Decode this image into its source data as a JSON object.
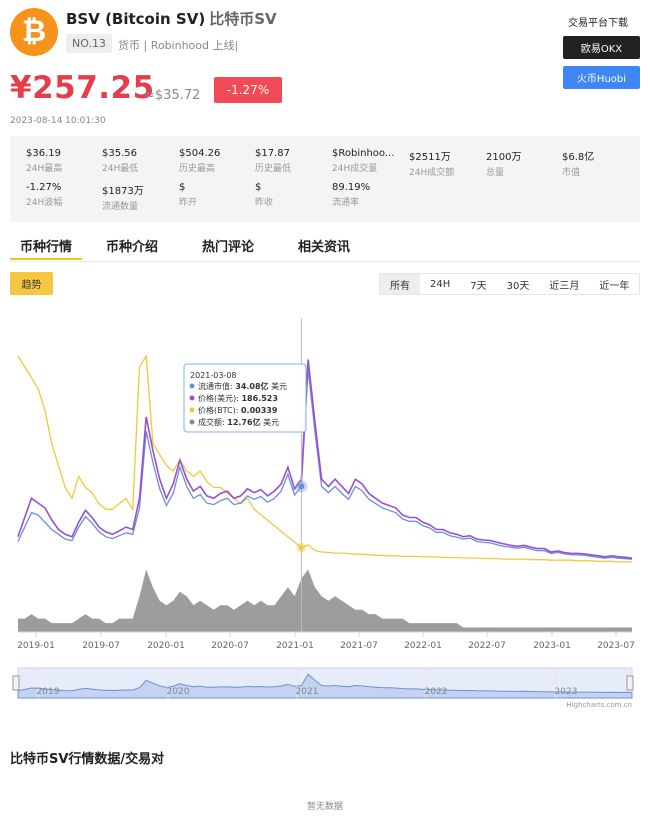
{
  "coin": {
    "logo_glyph": "₿",
    "name": "BSV (Bitcoin SV)",
    "name_cn": "比特币SV",
    "rank": "NO.13",
    "tags": "货币 | Robinhood 上线|",
    "price": "¥257.25",
    "price_usd": "≈$35.72",
    "change": "-1.27%",
    "timestamp": "2023-08-14 10:01:30"
  },
  "exchanges": {
    "title": "交易平台下载",
    "okx": "欧易OKX",
    "huobi": "火币Huobi"
  },
  "stats": [
    {
      "value": "$36.19",
      "label": "24H最高"
    },
    {
      "value": "$35.56",
      "label": "24H最低"
    },
    {
      "value": "$504.26",
      "label": "历史最高"
    },
    {
      "value": "$17.87",
      "label": "历史最低"
    },
    {
      "value": "$Robinhoo...",
      "label": "24H成交量"
    },
    {
      "value": "$2511万",
      "label": "24H成交额"
    },
    {
      "value": "2100万",
      "label": "总量"
    },
    {
      "value": "$6.8亿",
      "label": "市值"
    },
    {
      "value": "-1.27%",
      "label": "24H波幅"
    },
    {
      "value": "$1873万",
      "label": "流通数量"
    },
    {
      "value": "$",
      "label": "昨开"
    },
    {
      "value": "$",
      "label": "昨收"
    },
    {
      "value": "89.19%",
      "label": "流通率"
    }
  ],
  "tabs": [
    "币种行情",
    "币种介绍",
    "热门评论",
    "相关资讯"
  ],
  "controls": {
    "trend": "趋势",
    "ranges": [
      "所有",
      "24H",
      "7天",
      "30天",
      "近三月",
      "近一年"
    ],
    "active_range": "所有"
  },
  "colors": {
    "accent": "#f5c518",
    "price_red": "#e63d4b",
    "market_cap": "#6a8fde",
    "price_usd": "#9b4fd0",
    "price_btc": "#f0c93c",
    "volume": "#8c8c8c"
  },
  "chart_data": {
    "type": "line",
    "x_labels": [
      "2019-01",
      "2019-07",
      "2020-01",
      "2020-07",
      "2021-01",
      "2021-07",
      "2022-01",
      "2022-07",
      "2023-01",
      "2023-07"
    ],
    "navigator_labels": [
      "2019",
      "2020",
      "2021",
      "2022",
      "2023"
    ],
    "credit": "Highcharts.com.cn",
    "tooltip": {
      "date": "2021-03-08",
      "rows": [
        {
          "series": "流通市值",
          "value": "34.08亿",
          "unit": "美元"
        },
        {
          "series": "价格(美元)",
          "value": "186.523",
          "unit": ""
        },
        {
          "series": "价格(BTC)",
          "value": "0.00339",
          "unit": ""
        },
        {
          "series": "成交额",
          "value": "12.76亿",
          "unit": "美元"
        }
      ]
    },
    "series": [
      {
        "name": "价格(美元)",
        "values": [
          80,
          120,
          160,
          150,
          140,
          115,
          95,
          85,
          80,
          110,
          135,
          120,
          100,
          90,
          85,
          92,
          100,
          95,
          160,
          330,
          260,
          200,
          160,
          190,
          240,
          200,
          175,
          185,
          165,
          160,
          170,
          175,
          160,
          165,
          180,
          172,
          178,
          165,
          175,
          190,
          225,
          180,
          200,
          450,
          320,
          200,
          185,
          200,
          185,
          170,
          200,
          190,
          170,
          160,
          150,
          145,
          140,
          125,
          120,
          120,
          110,
          105,
          95,
          95,
          88,
          85,
          80,
          82,
          75,
          73,
          72,
          68,
          65,
          62,
          60,
          62,
          58,
          55,
          55,
          48,
          50,
          47,
          45,
          45,
          44,
          42,
          40,
          38,
          40,
          38,
          37,
          35
        ]
      },
      {
        "name": "流通市值",
        "values": [
          70,
          100,
          130,
          125,
          110,
          95,
          85,
          75,
          72,
          100,
          122,
          108,
          90,
          80,
          76,
          82,
          88,
          85,
          140,
          300,
          235,
          180,
          145,
          170,
          225,
          185,
          160,
          168,
          150,
          147,
          155,
          160,
          147,
          150,
          165,
          158,
          164,
          152,
          160,
          175,
          210,
          167,
          185,
          430,
          300,
          185,
          172,
          185,
          170,
          158,
          185,
          176,
          158,
          149,
          140,
          135,
          130,
          117,
          112,
          112,
          103,
          98,
          89,
          89,
          82,
          79,
          75,
          77,
          70,
          68,
          67,
          63,
          60,
          58,
          56,
          58,
          54,
          51,
          51,
          45,
          47,
          44,
          42,
          42,
          41,
          39,
          37,
          35,
          37,
          35,
          34,
          33
        ]
      },
      {
        "name": "价格(BTC)",
        "values": [
          0.04,
          0.038,
          0.036,
          0.034,
          0.03,
          0.024,
          0.02,
          0.016,
          0.014,
          0.018,
          0.016,
          0.015,
          0.013,
          0.012,
          0.012,
          0.013,
          0.014,
          0.012,
          0.038,
          0.04,
          0.024,
          0.022,
          0.02,
          0.019,
          0.021,
          0.019,
          0.018,
          0.019,
          0.017,
          0.016,
          0.016,
          0.015,
          0.014,
          0.013,
          0.014,
          0.012,
          0.011,
          0.01,
          0.009,
          0.008,
          0.007,
          0.006,
          0.005,
          0.0055,
          0.0045,
          0.0042,
          0.0041,
          0.004,
          0.004,
          0.0039,
          0.0038,
          0.0038,
          0.0037,
          0.0036,
          0.0036,
          0.0035,
          0.0035,
          0.0034,
          0.0034,
          0.0034,
          0.0033,
          0.0033,
          0.0033,
          0.0032,
          0.0032,
          0.0032,
          0.0031,
          0.0031,
          0.0031,
          0.003,
          0.003,
          0.003,
          0.0029,
          0.0029,
          0.0029,
          0.0029,
          0.0028,
          0.0028,
          0.0028,
          0.0027,
          0.0027,
          0.0027,
          0.0027,
          0.0026,
          0.0026,
          0.0026,
          0.0025,
          0.0025,
          0.0025,
          0.0024,
          0.0024,
          0.0024
        ]
      },
      {
        "name": "成交额",
        "values": [
          3,
          3,
          4,
          3,
          3,
          2,
          2,
          2,
          2,
          3,
          4,
          3,
          3,
          2,
          2,
          3,
          3,
          3,
          8,
          14,
          10,
          7,
          6,
          7,
          9,
          8,
          6,
          7,
          6,
          5,
          6,
          6,
          5,
          6,
          7,
          6,
          7,
          6,
          6,
          8,
          10,
          8,
          12,
          14,
          10,
          8,
          7,
          8,
          7,
          6,
          5,
          5,
          4,
          4,
          3,
          3,
          3,
          3,
          2,
          2,
          2,
          2,
          2,
          2,
          2,
          2,
          1,
          1,
          1,
          1,
          1,
          1,
          1,
          1,
          1,
          1,
          1,
          1,
          1,
          1,
          1,
          1,
          1,
          1,
          1,
          1,
          1,
          1,
          1,
          1,
          1,
          1
        ]
      }
    ]
  },
  "section_title": "比特币SV行情数据/交易对",
  "empty_text": "暂无数据"
}
